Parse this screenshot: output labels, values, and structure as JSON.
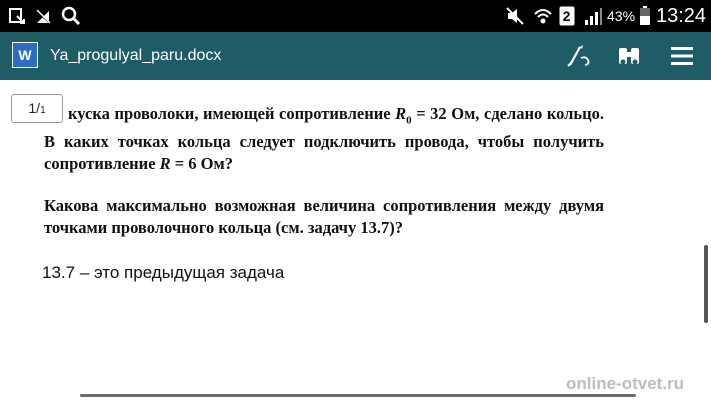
{
  "status_bar": {
    "battery": "43%",
    "time": "13:24",
    "sim_slot": "2",
    "icons": [
      "notification-icon",
      "signal-icon",
      "search-icon",
      "mute-icon",
      "wifi-icon",
      "sim-icon",
      "cell-signal-icon",
      "battery-icon"
    ]
  },
  "toolbar": {
    "app_icon_label": "W",
    "file_name": "Ya_progulyal_paru.docx",
    "icons": [
      "edit-icon",
      "find-icon",
      "menu-icon"
    ],
    "background": "#1e5c66"
  },
  "document": {
    "page_indicator": {
      "current": "1",
      "total": "1"
    },
    "problem_1": {
      "before_r0": "Из куска проволоки, имеющей сопротивление ",
      "r0_symbol": "R",
      "r0_sub": "0",
      "r0_value": " = 32 Ом, сделано кольцо. В каких точках кольца следует подключить провода, чтобы получить сопротивление ",
      "r_symbol": "R",
      "r_value": " = 6 Ом?"
    },
    "problem_2": "Какова максимально возможная величина сопротивления между двумя точками проволочного кольца (см. задачу 13.7)?",
    "note": "13.7 – это предыдущая задача"
  },
  "watermark": "online-otvet.ru"
}
